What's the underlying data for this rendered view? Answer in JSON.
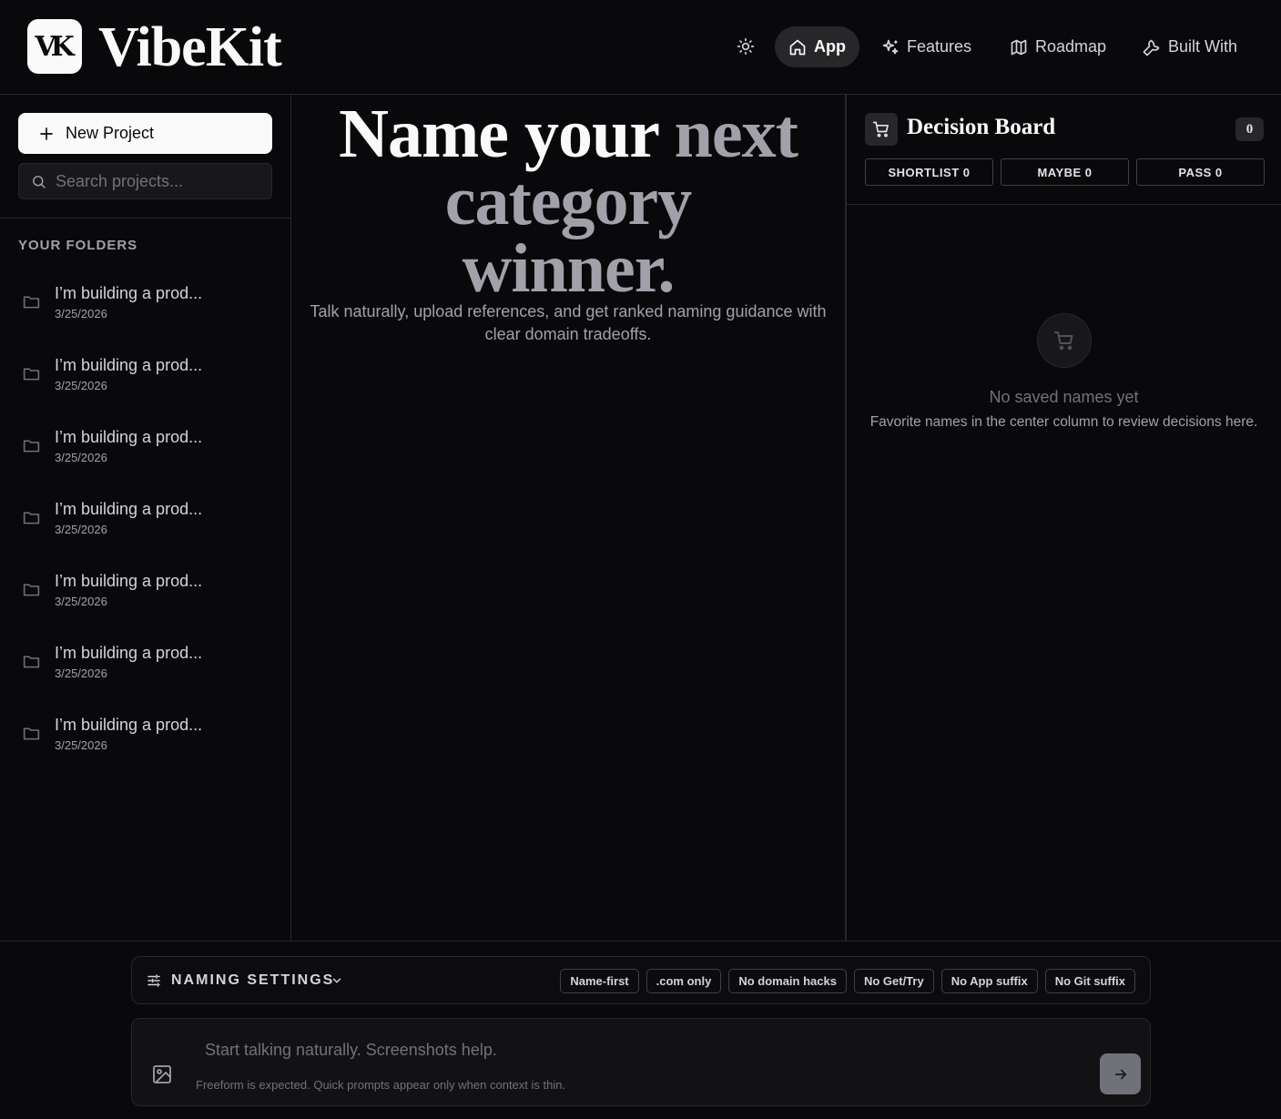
{
  "header": {
    "logo_mark": "VK",
    "brand": "VibeKit",
    "nav": [
      {
        "label": "App",
        "icon": "home-icon",
        "active": true
      },
      {
        "label": "Features",
        "icon": "sparkles-icon",
        "active": false
      },
      {
        "label": "Roadmap",
        "icon": "map-icon",
        "active": false
      },
      {
        "label": "Built With",
        "icon": "wrench-icon",
        "active": false
      }
    ]
  },
  "sidebar": {
    "new_project_label": "New Project",
    "search_placeholder": "Search projects...",
    "folders_heading": "YOUR FOLDERS",
    "folders": [
      {
        "title": "I’m building a prod...",
        "date": "3/25/2026"
      },
      {
        "title": "I’m building a prod...",
        "date": "3/25/2026"
      },
      {
        "title": "I’m building a prod...",
        "date": "3/25/2026"
      },
      {
        "title": "I’m building a prod...",
        "date": "3/25/2026"
      },
      {
        "title": "I’m building a prod...",
        "date": "3/25/2026"
      },
      {
        "title": "I’m building a prod...",
        "date": "3/25/2026"
      },
      {
        "title": "I’m building a prod...",
        "date": "3/25/2026"
      }
    ]
  },
  "main": {
    "hero": {
      "line1_white": "Name your ",
      "line1_gray": "next",
      "line2": "category",
      "line3": "winner."
    },
    "subtitle": "Talk naturally, upload references, and get ranked naming guidance with clear domain tradeoffs."
  },
  "board": {
    "title": "Decision Board",
    "count": "0",
    "tabs": [
      "SHORTLIST 0",
      "MAYBE 0",
      "PASS 0"
    ],
    "empty_title": "No saved names yet",
    "empty_subtitle": "Favorite names in the center column to review decisions here."
  },
  "settings": {
    "label": "NAMING SETTINGS",
    "chips": [
      "Name-first",
      ".com only",
      "No domain hacks",
      "No Get/Try",
      "No App suffix",
      "No Git suffix"
    ]
  },
  "composer": {
    "placeholder": "Start talking naturally. Screenshots help.",
    "hint": "Freeform is expected. Quick prompts appear only when context is thin."
  },
  "colors": {
    "background": "#09090b",
    "border": "#27272a",
    "muted_text": "#a1a1aa",
    "accent_white": "#fafafa"
  }
}
